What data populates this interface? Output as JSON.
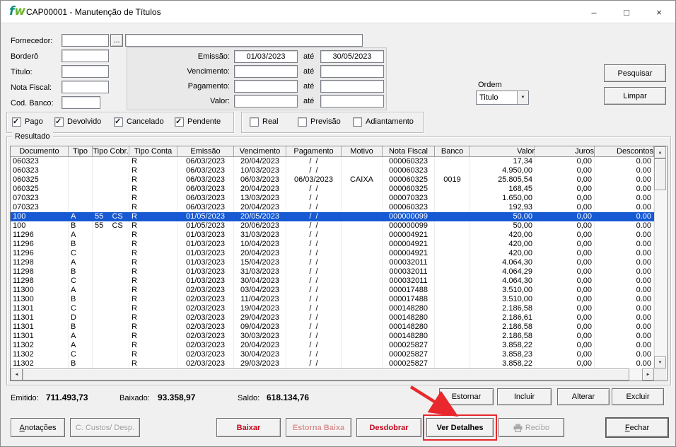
{
  "window": {
    "title": "CAP00001 - Manutenção de Títulos",
    "logo_f": "f",
    "logo_w": "w"
  },
  "icons": {
    "minimize": "–",
    "maximize": "□",
    "close": "×",
    "browse": "...",
    "dropdown": "▼",
    "check": "✓",
    "scroll_up": "▲",
    "scroll_down": "▼",
    "scroll_left": "◄",
    "scroll_right": "►"
  },
  "filters": {
    "fornecedor_label": "Fornecedor:",
    "fornecedor_code": "",
    "fornecedor_name": "",
    "bordero_label": "Borderô",
    "bordero_value": "",
    "titulo_label": "Título:",
    "titulo_value": "",
    "nota_fiscal_label": "Nota Fiscal:",
    "nota_fiscal_value": "",
    "cod_banco_label": "Cod. Banco:",
    "cod_banco_value": "",
    "emissao_label": "Emissão:",
    "emissao_de": "01/03/2023",
    "emissao_ate": "30/05/2023",
    "vencimento_label": "Vencimento:",
    "vencimento_de": "",
    "vencimento_ate": "",
    "pagamento_label": "Pagamento:",
    "pagamento_de": "",
    "pagamento_ate": "",
    "valor_label": "Valor:",
    "valor_de": "",
    "valor_ate": "",
    "ate_label": "até",
    "ordem_label": "Ordem",
    "ordem_value": "Titulo",
    "pesquisar_button": "Pesquisar",
    "limpar_button": "Limpar"
  },
  "status_filters": {
    "group1": [
      {
        "label": "Pago",
        "checked": true
      },
      {
        "label": "Devolvido",
        "checked": true
      },
      {
        "label": "Cancelado",
        "checked": true
      },
      {
        "label": "Pendente",
        "checked": true
      }
    ],
    "group2": [
      {
        "label": "Real",
        "checked": false
      },
      {
        "label": "Previsão",
        "checked": false
      },
      {
        "label": "Adiantamento",
        "checked": false
      }
    ]
  },
  "result": {
    "group_label": "Resultado",
    "columns": [
      "Documento",
      "Tipo",
      "Tipo Cobr.",
      "Tipo Conta",
      "Emissão",
      "Vencimento",
      "Pagamento",
      "Motivo",
      "Nota Fiscal",
      "Banco",
      "Valor",
      "Juros",
      "Descontos"
    ],
    "selected_row_index": 6,
    "rows": [
      [
        "060323",
        "",
        "",
        "R",
        "06/03/2023",
        "20/04/2023",
        "/  /",
        "",
        "000060323",
        "",
        "17,34",
        "0,00",
        "0.00"
      ],
      [
        "060323",
        "",
        "",
        "R",
        "06/03/2023",
        "10/03/2023",
        "/  /",
        "",
        "000060323",
        "",
        "4.950,00",
        "0,00",
        "0.00"
      ],
      [
        "060325",
        "",
        "",
        "R",
        "06/03/2023",
        "06/03/2023",
        "06/03/2023",
        "CAIXA",
        "000060325",
        "0019",
        "25.805,54",
        "0,00",
        "0.00"
      ],
      [
        "060325",
        "",
        "",
        "R",
        "06/03/2023",
        "20/04/2023",
        "/  /",
        "",
        "000060325",
        "",
        "168,45",
        "0,00",
        "0.00"
      ],
      [
        "070323",
        "",
        "",
        "R",
        "06/03/2023",
        "13/03/2023",
        "/  /",
        "",
        "000070323",
        "",
        "1.650,00",
        "0,00",
        "0.00"
      ],
      [
        "070323",
        "",
        "",
        "R",
        "06/03/2023",
        "20/04/2023",
        "/  /",
        "",
        "000060323",
        "",
        "192,93",
        "0,00",
        "0.00"
      ],
      [
        "100",
        "A",
        "55    CS",
        "R",
        "01/05/2023",
        "20/05/2023",
        "/  /",
        "",
        "000000099",
        "",
        "50,00",
        "0,00",
        "0.00"
      ],
      [
        "100",
        "B",
        "55    CS",
        "R",
        "01/05/2023",
        "20/06/2023",
        "/  /",
        "",
        "000000099",
        "",
        "50,00",
        "0,00",
        "0.00"
      ],
      [
        "11296",
        "A",
        "",
        "R",
        "01/03/2023",
        "31/03/2023",
        "/  /",
        "",
        "000004921",
        "",
        "420,00",
        "0,00",
        "0.00"
      ],
      [
        "11296",
        "B",
        "",
        "R",
        "01/03/2023",
        "10/04/2023",
        "/  /",
        "",
        "000004921",
        "",
        "420,00",
        "0,00",
        "0.00"
      ],
      [
        "11296",
        "C",
        "",
        "R",
        "01/03/2023",
        "20/04/2023",
        "/  /",
        "",
        "000004921",
        "",
        "420,00",
        "0,00",
        "0.00"
      ],
      [
        "11298",
        "A",
        "",
        "R",
        "01/03/2023",
        "15/04/2023",
        "/  /",
        "",
        "000032011",
        "",
        "4.064,30",
        "0,00",
        "0.00"
      ],
      [
        "11298",
        "B",
        "",
        "R",
        "01/03/2023",
        "31/03/2023",
        "/  /",
        "",
        "000032011",
        "",
        "4.064,29",
        "0,00",
        "0.00"
      ],
      [
        "11298",
        "C",
        "",
        "R",
        "01/03/2023",
        "30/04/2023",
        "/  /",
        "",
        "000032011",
        "",
        "4.064,30",
        "0,00",
        "0.00"
      ],
      [
        "11300",
        "A",
        "",
        "R",
        "02/03/2023",
        "03/04/2023",
        "/  /",
        "",
        "000017488",
        "",
        "3.510,00",
        "0,00",
        "0.00"
      ],
      [
        "11300",
        "B",
        "",
        "R",
        "02/03/2023",
        "11/04/2023",
        "/  /",
        "",
        "000017488",
        "",
        "3.510,00",
        "0,00",
        "0.00"
      ],
      [
        "11301",
        "C",
        "",
        "R",
        "02/03/2023",
        "19/04/2023",
        "/  /",
        "",
        "000148280",
        "",
        "2.186,58",
        "0,00",
        "0.00"
      ],
      [
        "11301",
        "D",
        "",
        "R",
        "02/03/2023",
        "29/04/2023",
        "/  /",
        "",
        "000148280",
        "",
        "2.186,61",
        "0,00",
        "0.00"
      ],
      [
        "11301",
        "B",
        "",
        "R",
        "02/03/2023",
        "09/04/2023",
        "/  /",
        "",
        "000148280",
        "",
        "2.186,58",
        "0,00",
        "0.00"
      ],
      [
        "11301",
        "A",
        "",
        "R",
        "02/03/2023",
        "30/03/2023",
        "/  /",
        "",
        "000148280",
        "",
        "2.186,58",
        "0,00",
        "0.00"
      ],
      [
        "11302",
        "A",
        "",
        "R",
        "02/03/2023",
        "20/04/2023",
        "/  /",
        "",
        "000025827",
        "",
        "3.858,22",
        "0,00",
        "0.00"
      ],
      [
        "11302",
        "C",
        "",
        "R",
        "02/03/2023",
        "30/04/2023",
        "/  /",
        "",
        "000025827",
        "",
        "3.858,23",
        "0,00",
        "0.00"
      ],
      [
        "11302",
        "B",
        "",
        "R",
        "02/03/2023",
        "29/03/2023",
        "/  /",
        "",
        "000025827",
        "",
        "3.858,22",
        "0,00",
        "0.00"
      ]
    ]
  },
  "summary": {
    "emitido_label": "Emitido:",
    "emitido_value": "711.493,73",
    "baixado_label": "Baixado:",
    "baixado_value": "93.358,97",
    "saldo_label": "Saldo:",
    "saldo_value": "618.134,76"
  },
  "actions": {
    "estornar": "Estornar",
    "incluir": "Incluir",
    "alterar": "Alterar",
    "excluir": "Excluir",
    "anotacoes": "Anotações",
    "custos_desp": "C. Custos/ Desp.",
    "baixar": "Baixar",
    "estorna_baixa": "Estorna Baixa",
    "desdobrar": "Desdobrar",
    "ver_detalhes": "Ver Detalhes",
    "recibo": "Recibo",
    "fechar": "Fechar"
  },
  "colors": {
    "selection_blue": "#1659d2",
    "annotation_red": "#e8282d",
    "action_red": "#c20a1e",
    "logo_f_teal": "#0a8f7b",
    "logo_w_green": "#6ab42f"
  }
}
